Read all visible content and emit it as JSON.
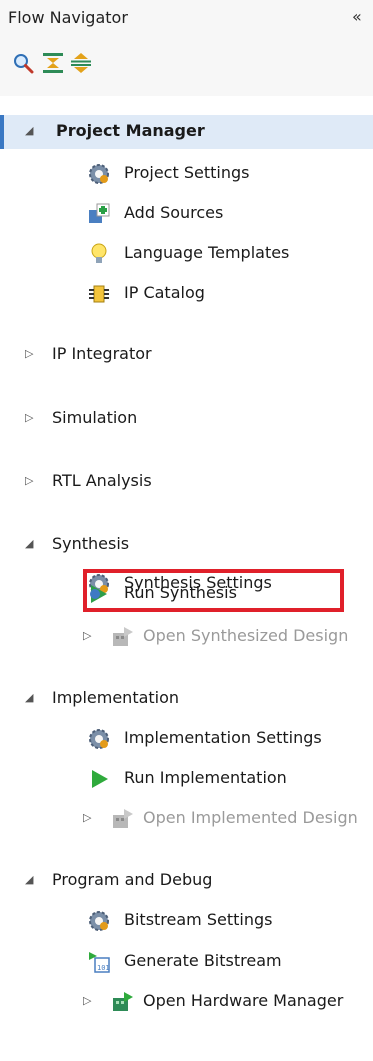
{
  "header": {
    "title": "Flow Navigator",
    "collapse_glyph": "«"
  },
  "toolbar": {
    "icons": [
      "search-icon",
      "collapse-all-icon",
      "expand-all-icon"
    ]
  },
  "tree": {
    "project_manager": {
      "label": "Project Manager",
      "items": {
        "project_settings": "Project Settings",
        "add_sources": "Add Sources",
        "language_templates": "Language Templates",
        "ip_catalog": "IP Catalog"
      }
    },
    "ip_integrator": {
      "label": "IP Integrator"
    },
    "simulation": {
      "label": "Simulation"
    },
    "rtl_analysis": {
      "label": "RTL Analysis"
    },
    "synthesis": {
      "label": "Synthesis",
      "items": {
        "settings": "Synthesis Settings",
        "run": "Run Synthesis",
        "open": "Open Synthesized Design"
      }
    },
    "implementation": {
      "label": "Implementation",
      "items": {
        "settings": "Implementation Settings",
        "run": "Run Implementation",
        "open": "Open Implemented Design"
      }
    },
    "program_debug": {
      "label": "Program and Debug",
      "items": {
        "bitstream_settings": "Bitstream Settings",
        "generate_bitstream": "Generate Bitstream",
        "hardware_manager": "Open Hardware Manager"
      }
    }
  },
  "colors": {
    "highlight_border": "#e0202a",
    "selected_bg": "#dfeaf7",
    "accent": "#3a78c3",
    "disabled_text": "#9a9a9a"
  }
}
